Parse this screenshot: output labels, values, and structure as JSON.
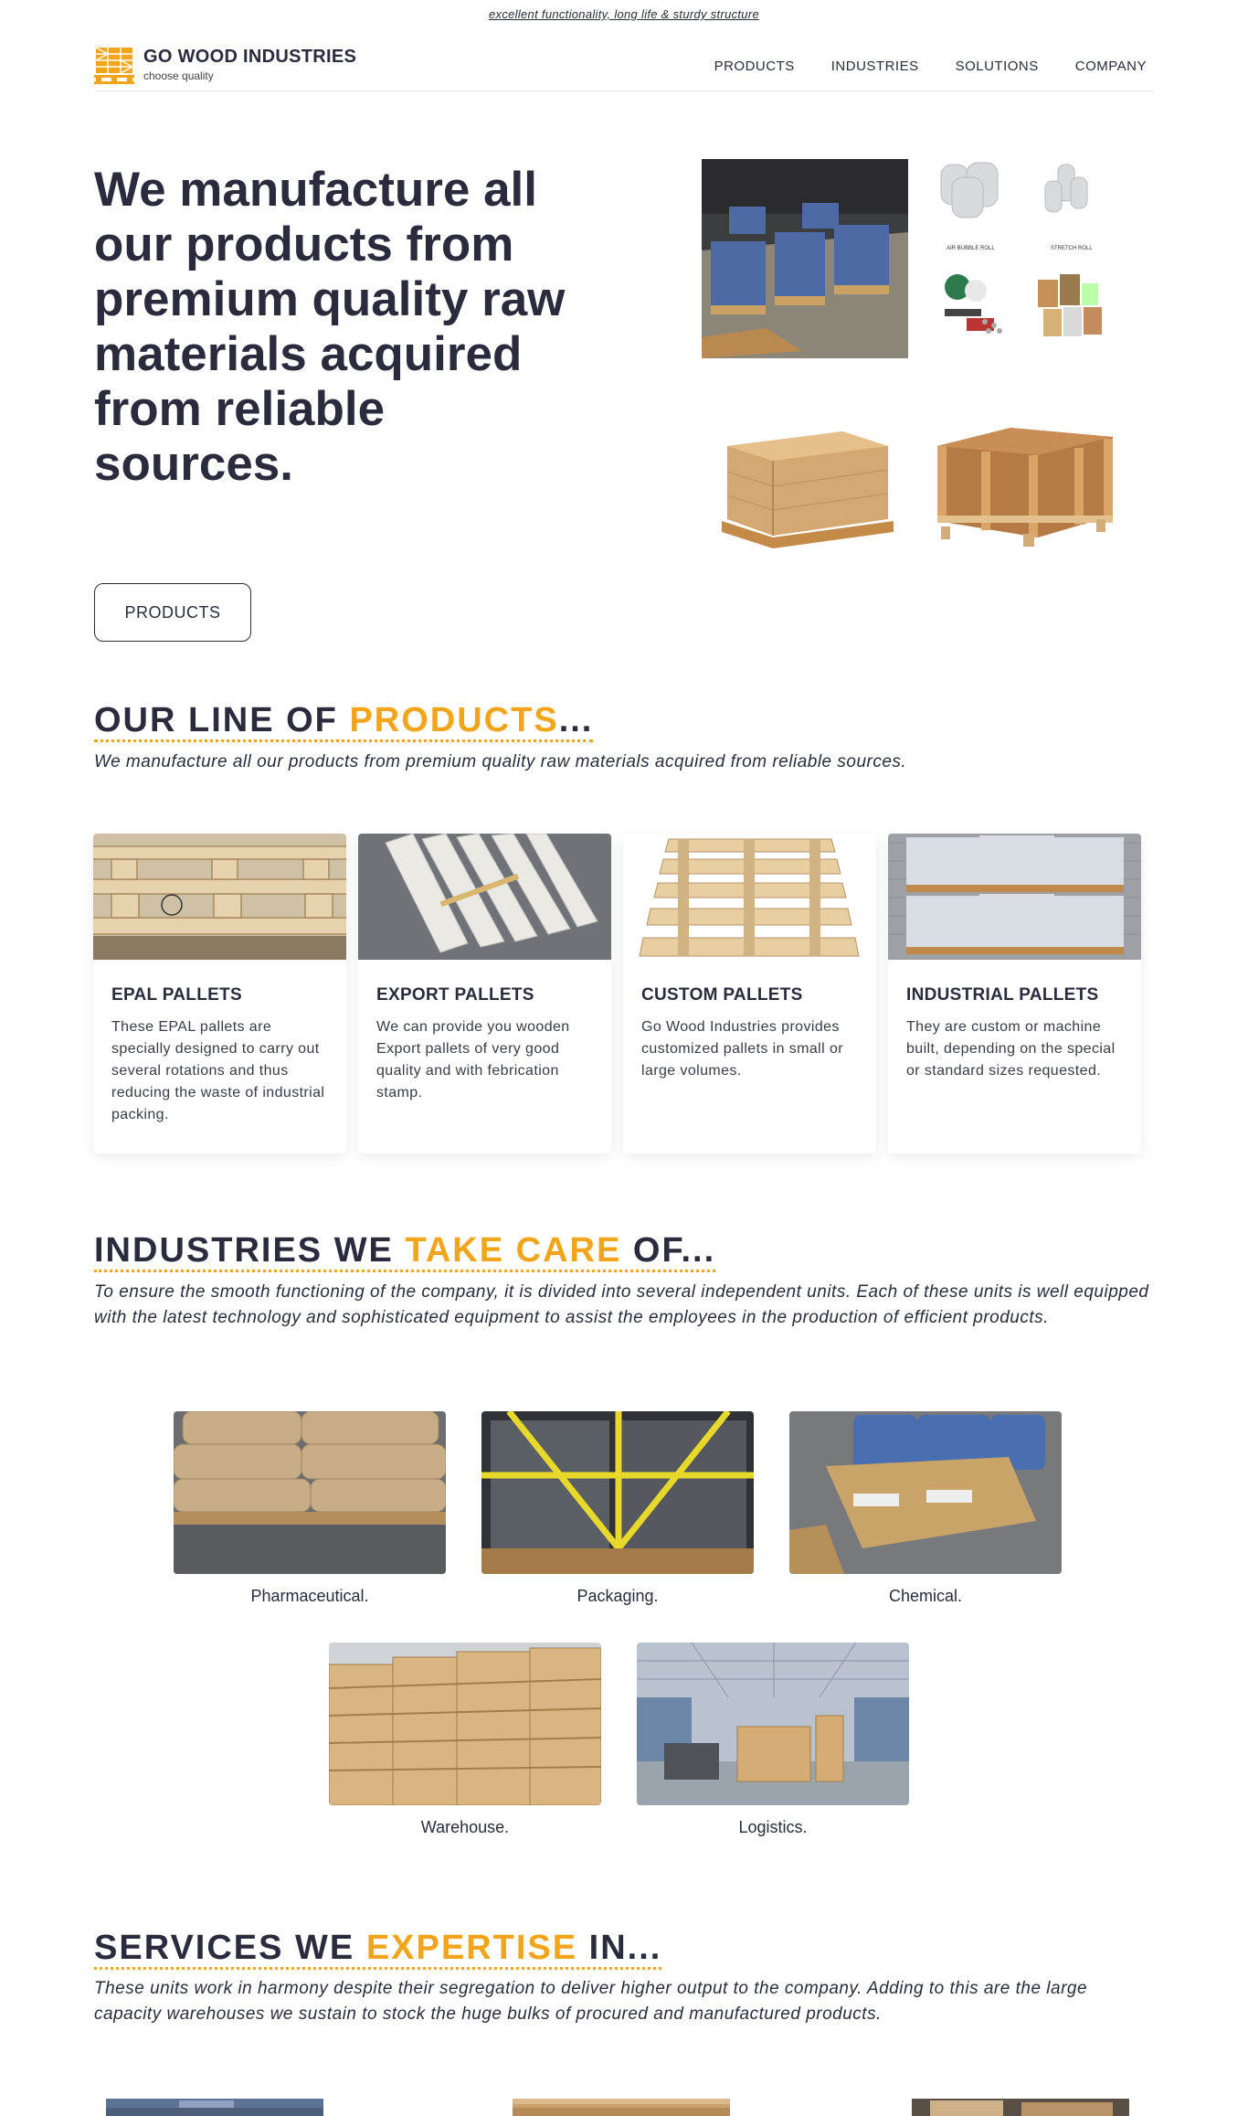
{
  "tagline": "excellent functionality, long life & sturdy structure",
  "brand": {
    "name": "GO WOOD INDUSTRIES",
    "tagline": "choose quality",
    "icon": "pallet-logo-icon",
    "accent_color": "#f2a51b",
    "dark_color": "#2a2b3d"
  },
  "nav": {
    "products": "PRODUCTS",
    "industries": "INDUSTRIES",
    "solutions": "SOLUTIONS",
    "company": "COMPANY"
  },
  "hero": {
    "title": "We manufacture all our products from premium quality raw materials acquired from reliable sources.",
    "button": "PRODUCTS",
    "images": {
      "bubble_label": "AIR BUBBLE ROLL",
      "stretch_label": "STRETCH ROLL"
    }
  },
  "products_section": {
    "title_part1": "OUR LINE OF ",
    "title_part2": "PRODUCTS",
    "title_part3": "...",
    "subtitle": "We manufacture all our products from premium quality raw materials acquired from reliable sources.",
    "cards": [
      {
        "title": "EPAL PALLETS",
        "text": "These EPAL pallets are specially designed to carry out several rotations and thus reducing the waste of industrial packing."
      },
      {
        "title": "EXPORT PALLETS",
        "text": "We can provide you wooden Export pallets of very good quality and with febrication stamp."
      },
      {
        "title": "CUSTOM PALLETS",
        "text": "Go Wood Industries provides customized pallets in small or large volumes."
      },
      {
        "title": "INDUSTRIAL PALLETS",
        "text": "They are custom or machine built, depending on the special or standard sizes requested."
      }
    ]
  },
  "industries_section": {
    "title_part1": "INDUSTRIES WE ",
    "title_part2": "TAKE CARE ",
    "title_part3": "OF...",
    "subtitle": "To ensure the smooth functioning of the company, it is divided into several independent units. Each of these units is well equipped with the latest technology and sophisticated equipment to assist the employees in the production of efficient products.",
    "items": [
      "Pharmaceutical.",
      "Packaging.",
      "Chemical.",
      "Warehouse.",
      "Logistics."
    ]
  },
  "services_section": {
    "title_part1": "SERVICES WE ",
    "title_part2": "EXPERTISE ",
    "title_part3": "IN...",
    "subtitle": "These units work in harmony despite their segregation to deliver higher output to the company. Adding to this are the large capacity warehouses we sustain to stock the huge bulks of procured and manufactured products."
  }
}
